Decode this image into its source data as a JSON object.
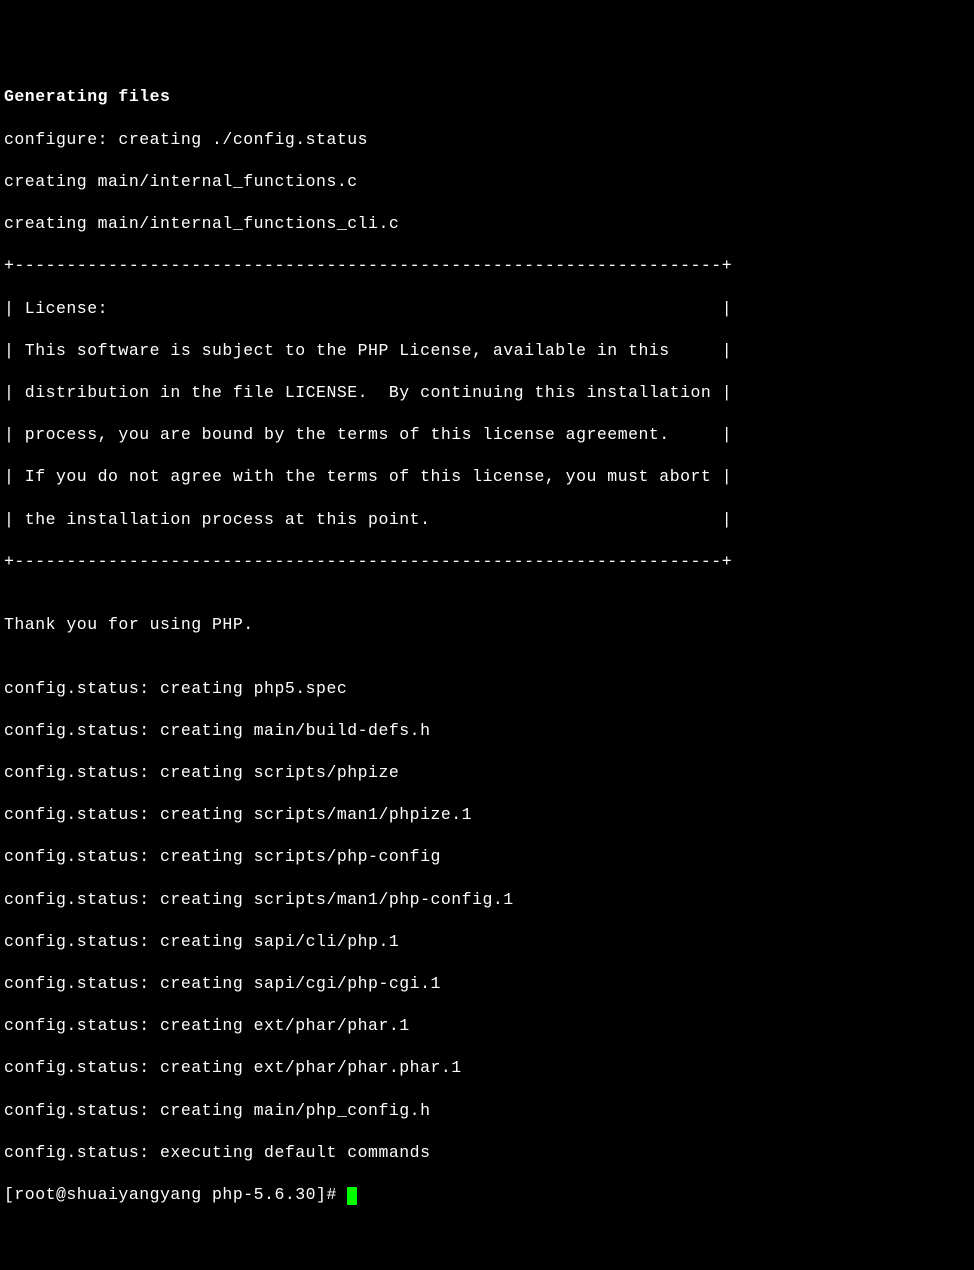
{
  "lines": {
    "l0": "Generating files",
    "l1": "configure: creating ./config.status",
    "l2": "creating main/internal_functions.c",
    "l3": "creating main/internal_functions_cli.c",
    "l4": "+--------------------------------------------------------------------+",
    "l5": "| License:                                                           |",
    "l6": "| This software is subject to the PHP License, available in this     |",
    "l7": "| distribution in the file LICENSE.  By continuing this installation |",
    "l8": "| process, you are bound by the terms of this license agreement.     |",
    "l9": "| If you do not agree with the terms of this license, you must abort |",
    "l10": "| the installation process at this point.                            |",
    "l11": "+--------------------------------------------------------------------+",
    "l12": "",
    "l13": "Thank you for using PHP.",
    "l14": "",
    "l15": "config.status: creating php5.spec",
    "l16": "config.status: creating main/build-defs.h",
    "l17": "config.status: creating scripts/phpize",
    "l18": "config.status: creating scripts/man1/phpize.1",
    "l19": "config.status: creating scripts/php-config",
    "l20": "config.status: creating scripts/man1/php-config.1",
    "l21": "config.status: creating sapi/cli/php.1",
    "l22": "config.status: creating sapi/cgi/php-cgi.1",
    "l23": "config.status: creating ext/phar/phar.1",
    "l24": "config.status: creating ext/phar/phar.phar.1",
    "l25": "config.status: creating main/php_config.h",
    "l26": "config.status: executing default commands",
    "prompt": "[root@shuaiyangyang php-5.6.30]# "
  }
}
